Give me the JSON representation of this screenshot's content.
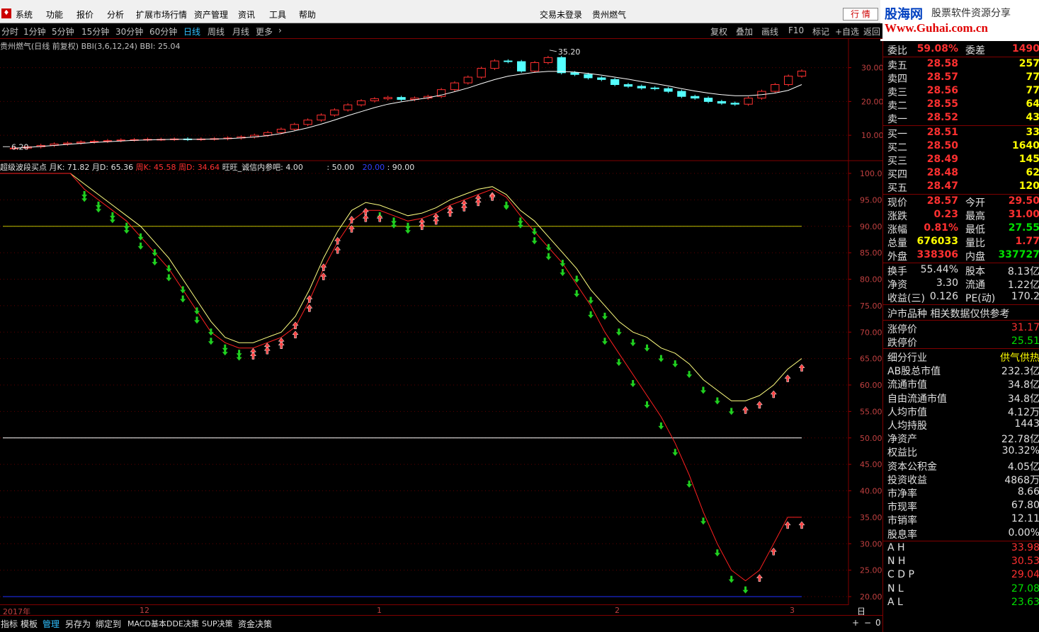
{
  "menubar": {
    "items": [
      "系统",
      "功能",
      "报价",
      "分析",
      "扩展市场行情",
      "资产管理",
      "资讯",
      "工具",
      "帮助"
    ],
    "login_status": "交易未登录",
    "stock_name": "贵州燃气",
    "hangqing": "行 情"
  },
  "brand": {
    "name": "股海网",
    "slogan": "股票软件资源分享",
    "url": "Www.Guhai.com.cn"
  },
  "periods": [
    "分时",
    "1分钟",
    "5分钟",
    "15分钟",
    "30分钟",
    "60分钟",
    "日线",
    "周线",
    "月线",
    "更多"
  ],
  "active_period": "日线",
  "tools": [
    "复权",
    "叠加",
    "画线",
    "F10",
    "标记",
    "+自选",
    "返回"
  ],
  "main_chart": {
    "title": "贵州燃气(日线 前复权) BBI(3,6,12,24) BBI: 25.04",
    "high_label": "35.20",
    "low_label": "6.20",
    "y_ticks": [
      "30.00",
      "20.00",
      "10.00"
    ]
  },
  "indicator": {
    "name": "超级波段买点",
    "yk_label": "月K: 71.82",
    "yd_label": "月D: 65.36",
    "zk_label": "周K: 45.58",
    "zd_label": "周D: 34.64",
    "wang_label": "旺旺_诚信内参吧: 4.00",
    "l50": ": 50.00",
    "l20": "20.00",
    "l90": ": 90.00",
    "y_ticks": [
      "100.0",
      "95.00",
      "90.00",
      "85.00",
      "80.00",
      "75.00",
      "70.00",
      "65.00",
      "60.00",
      "55.00",
      "50.00",
      "45.00",
      "40.00",
      "35.00",
      "30.00",
      "25.00",
      "20.00"
    ]
  },
  "time_axis": {
    "labels": [
      "2017年",
      "12",
      "1",
      "2",
      "3"
    ],
    "right_label": "日线"
  },
  "bottom_tabs": [
    "指标",
    "模板",
    "管理",
    "另存为",
    "绑定到",
    "MACD基本",
    "DDE决策",
    "SUP决策",
    "资金决策"
  ],
  "active_tab": "管理",
  "bottom_right": [
    "+",
    "−",
    "0"
  ],
  "quote": {
    "weibi": {
      "label": "委比",
      "value": "59.08%",
      "label2": "委差",
      "value2": "1490"
    },
    "sell": [
      {
        "label": "卖五",
        "price": "28.58",
        "vol": "257"
      },
      {
        "label": "卖四",
        "price": "28.57",
        "vol": "77"
      },
      {
        "label": "卖三",
        "price": "28.56",
        "vol": "77"
      },
      {
        "label": "卖二",
        "price": "28.55",
        "vol": "64"
      },
      {
        "label": "卖一",
        "price": "28.52",
        "vol": "43"
      }
    ],
    "buy": [
      {
        "label": "买一",
        "price": "28.51",
        "vol": "33"
      },
      {
        "label": "买二",
        "price": "28.50",
        "vol": "1640"
      },
      {
        "label": "买三",
        "price": "28.49",
        "vol": "145"
      },
      {
        "label": "买四",
        "price": "28.48",
        "vol": "62"
      },
      {
        "label": "买五",
        "price": "28.47",
        "vol": "120"
      }
    ],
    "stats": [
      {
        "l1": "现价",
        "v1": "28.57",
        "c1": "red",
        "l2": "今开",
        "v2": "29.50",
        "c2": "red"
      },
      {
        "l1": "涨跌",
        "v1": "0.23",
        "c1": "red",
        "l2": "最高",
        "v2": "31.00",
        "c2": "red"
      },
      {
        "l1": "涨幅",
        "v1": "0.81%",
        "c1": "red",
        "l2": "最低",
        "v2": "27.55",
        "c2": "green"
      },
      {
        "l1": "总量",
        "v1": "676033",
        "c1": "yellow",
        "l2": "量比",
        "v2": "1.77",
        "c2": "red"
      },
      {
        "l1": "外盘",
        "v1": "338306",
        "c1": "red",
        "l2": "内盘",
        "v2": "337727",
        "c2": "green"
      }
    ],
    "stats2": [
      {
        "l1": "换手",
        "v1": "55.44%",
        "l2": "股本",
        "v2": "8.13亿"
      },
      {
        "l1": "净资",
        "v1": "3.30",
        "l2": "流通",
        "v2": "1.22亿"
      },
      {
        "l1": "收益(三)",
        "v1": "0.126",
        "l2": "PE(动)",
        "v2": "170.2"
      }
    ],
    "section_title": "沪市品种  相关数据仅供参考",
    "limit": [
      {
        "label": "涨停价",
        "value": "31.17",
        "color": "red"
      },
      {
        "label": "跌停价",
        "value": "25.51",
        "color": "green"
      }
    ],
    "info": [
      {
        "label": "细分行业",
        "value": "供气供热",
        "color": "yellow"
      },
      {
        "label": "AB股总市值",
        "value": "232.3亿",
        "color": "white"
      },
      {
        "label": "流通市值",
        "value": "34.8亿",
        "color": "white"
      },
      {
        "label": "自由流通市值",
        "value": "34.8亿",
        "color": "white"
      },
      {
        "label": "人均市值",
        "value": "4.12万",
        "color": "white"
      },
      {
        "label": "人均持股",
        "value": "1443",
        "color": "white"
      },
      {
        "label": "净资产",
        "value": "22.78亿",
        "color": "white"
      },
      {
        "label": "权益比",
        "value": "30.32%",
        "color": "white"
      },
      {
        "label": "资本公积金",
        "value": "4.05亿",
        "color": "white"
      },
      {
        "label": "投资收益",
        "value": "4868万",
        "color": "white"
      },
      {
        "label": "市净率",
        "value": "8.66",
        "color": "white"
      },
      {
        "label": "市现率",
        "value": "67.80",
        "color": "white"
      },
      {
        "label": "市销率",
        "value": "12.11",
        "color": "white"
      },
      {
        "label": "股息率",
        "value": "0.00%",
        "color": "white"
      }
    ],
    "pivots": [
      {
        "label": "A H",
        "value": "33.98",
        "color": "red"
      },
      {
        "label": "N H",
        "value": "30.53",
        "color": "red"
      },
      {
        "label": "C D P",
        "value": "29.04",
        "color": "red"
      },
      {
        "label": "N L",
        "value": "27.08",
        "color": "green"
      },
      {
        "label": "A L",
        "value": "23.63",
        "color": "green"
      }
    ]
  },
  "chart_data": [
    {
      "type": "candlestick",
      "title": "贵州燃气(日线 前复权)",
      "indicator": "BBI(3,6,12,24)",
      "ylim": [
        5,
        36
      ],
      "close": [
        6.2,
        6.6,
        7.0,
        7.4,
        7.7,
        8.0,
        8.2,
        8.4,
        8.6,
        8.7,
        8.8,
        8.8,
        8.9,
        8.8,
        8.9,
        9.0,
        9.2,
        9.5,
        10.0,
        10.8,
        11.8,
        13.2,
        14.5,
        16.0,
        17.5,
        19.0,
        20.2,
        20.8,
        21.2,
        20.6,
        21.0,
        21.5,
        23.5,
        25.5,
        27.2,
        29.8,
        32.0,
        31.8,
        29.0,
        31.5,
        33.0,
        28.5,
        28.0,
        27.0,
        26.5,
        25.0,
        24.5,
        24.0,
        23.8,
        23.0,
        21.5,
        21.0,
        20.0,
        19.5,
        19.2,
        21.0,
        23.0,
        25.0,
        27.5,
        29.0
      ],
      "bbi": [
        6.2,
        6.4,
        6.7,
        7.0,
        7.3,
        7.6,
        7.9,
        8.1,
        8.3,
        8.5,
        8.6,
        8.7,
        8.8,
        8.8,
        8.8,
        8.9,
        9.0,
        9.2,
        9.5,
        9.9,
        10.5,
        11.3,
        12.2,
        13.3,
        14.5,
        15.8,
        17.0,
        18.2,
        19.2,
        19.9,
        20.5,
        21.1,
        21.9,
        22.9,
        24.0,
        25.3,
        26.5,
        27.5,
        28.1,
        28.6,
        28.9,
        28.9,
        28.7,
        28.3,
        27.8,
        27.2,
        26.6,
        25.9,
        25.3,
        24.6,
        23.8,
        23.1,
        22.5,
        22.0,
        21.7,
        21.7,
        22.0,
        22.5,
        23.3,
        25.0
      ]
    },
    {
      "type": "line",
      "title": "超级波段买点",
      "ylim": [
        20,
        100
      ],
      "series": [
        {
          "name": "月K",
          "values": [
            100,
            100,
            100,
            100,
            100,
            100,
            98,
            96,
            94,
            92,
            90,
            87,
            84,
            80,
            76,
            72,
            69,
            68,
            68,
            69,
            70,
            73,
            78,
            84,
            89,
            93,
            94.5,
            94,
            93,
            92,
            92.5,
            93.5,
            95,
            96,
            97,
            97.5,
            96,
            93,
            91,
            88,
            85,
            82,
            78,
            75,
            72,
            70,
            69,
            67,
            66,
            64,
            61,
            59,
            57,
            57,
            58,
            60,
            63,
            65
          ]
        },
        {
          "name": "月D",
          "values": [
            100,
            100,
            100,
            100,
            100,
            100,
            97,
            95,
            93,
            91,
            88,
            85,
            82,
            78,
            74,
            70,
            68,
            67,
            67,
            68,
            69,
            71,
            76,
            82,
            87,
            91,
            93,
            93,
            92,
            91,
            91.5,
            92.5,
            94,
            95,
            96,
            97,
            95.5,
            92,
            89,
            86,
            83,
            79,
            75,
            70,
            66,
            62,
            58,
            54,
            49,
            43,
            36,
            30,
            25,
            23,
            25,
            30,
            35,
            35
          ]
        }
      ],
      "reference_lines": [
        90,
        50,
        20
      ]
    }
  ]
}
